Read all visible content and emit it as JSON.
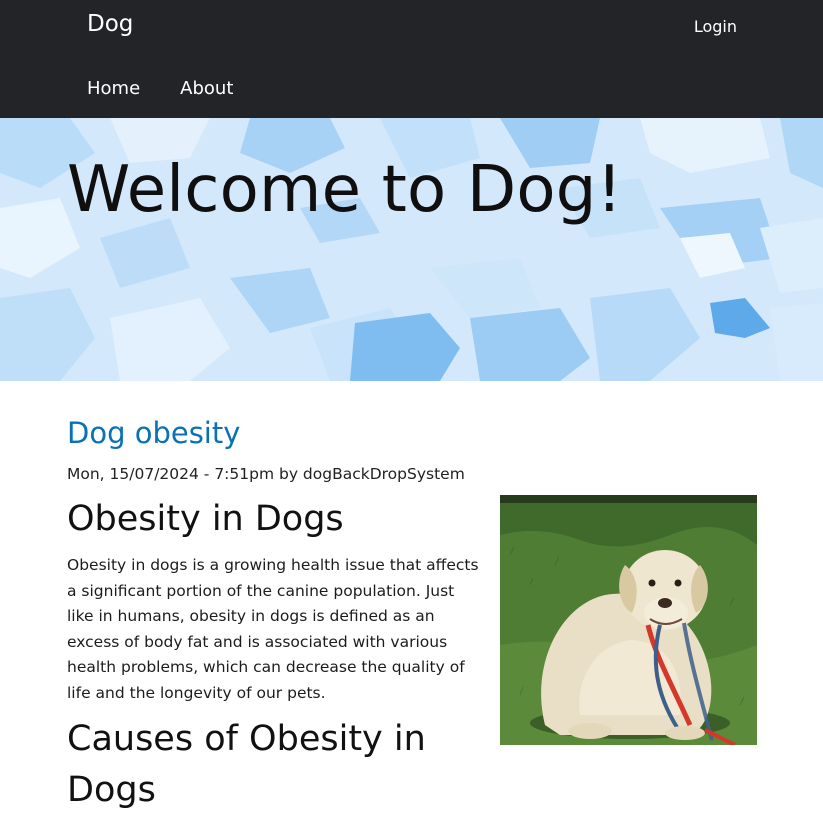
{
  "header": {
    "site_name": "Dog",
    "login_label": "Login",
    "nav": [
      {
        "label": "Home"
      },
      {
        "label": "About"
      }
    ]
  },
  "hero": {
    "title": "Welcome to Dog!"
  },
  "article": {
    "title": "Dog obesity",
    "meta": "Mon, 15/07/2024 - 7:51pm by dogBackDropSystem",
    "image_alt": "Overweight yellow Labrador sitting on grass holding a red leash",
    "heading_1": "Obesity in Dogs",
    "paragraph_1": "Obesity in dogs is a growing health issue that affects a significant portion of the canine population. Just like in humans, obesity in dogs is defined as an excess of body fat and is associated with various health problems, which can decrease the quality of life and the longevity of our pets.",
    "heading_2": "Causes of Obesity in Dogs"
  },
  "colors": {
    "header_bg": "#222428",
    "link": "#0a70b8",
    "hero_bg": "#cfe6fb"
  }
}
